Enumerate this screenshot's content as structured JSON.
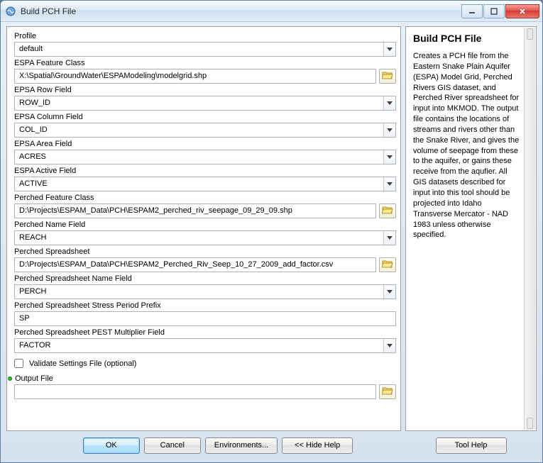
{
  "window": {
    "title": "Build PCH File"
  },
  "help": {
    "title": "Build PCH File",
    "body": "Creates a PCH file from the Eastern Snake Plain Aquifer (ESPA) Model Grid, Perched Rivers GIS dataset, and Perched River spreadsheet for input into MKMOD. The output file contains the locations of streams and rivers other than the Snake River, and gives the volume of seepage from these to the aquifer, or gains these receive from the aqufier. All GIS datasets described for input into this tool should be projected into Idaho Transverse Mercator - NAD 1983 unless otherwise specified."
  },
  "fields": {
    "profile": {
      "label": "Profile",
      "value": "default"
    },
    "espa_fc": {
      "label": "ESPA Feature Class",
      "value": "X:\\Spatial\\GroundWater\\ESPAModeling\\modelgrid.shp"
    },
    "espa_row": {
      "label": "EPSA Row Field",
      "value": "ROW_ID"
    },
    "espa_col": {
      "label": "EPSA Column Field",
      "value": "COL_ID"
    },
    "espa_area": {
      "label": "EPSA Area Field",
      "value": "ACRES"
    },
    "espa_active": {
      "label": "ESPA Active Field",
      "value": "ACTIVE"
    },
    "perched_fc": {
      "label": "Perched Feature Class",
      "value": "D:\\Projects\\ESPAM_Data\\PCH\\ESPAM2_perched_riv_seepage_09_29_09.shp"
    },
    "perched_name": {
      "label": "Perched Name Field",
      "value": "REACH"
    },
    "perched_ss": {
      "label": "Perched Spreadsheet",
      "value": "D:\\Projects\\ESPAM_Data\\PCH\\ESPAM2_Perched_Riv_Seep_10_27_2009_add_factor.csv"
    },
    "perched_ss_name": {
      "label": "Perched Spreadsheet Name Field",
      "value": "PERCH"
    },
    "perched_ss_prefix": {
      "label": "Perched Spreadsheet Stress Period Prefix",
      "value": "SP"
    },
    "perched_ss_pest": {
      "label": "Perched Spreadsheet PEST Multiplier Field",
      "value": "FACTOR"
    },
    "validate": {
      "label": "Validate Settings File (optional)"
    },
    "output": {
      "label": "Output File",
      "value": ""
    }
  },
  "buttons": {
    "ok": "OK",
    "cancel": "Cancel",
    "env": "Environments...",
    "hidehelp": "<< Hide Help",
    "toolhelp": "Tool Help"
  }
}
